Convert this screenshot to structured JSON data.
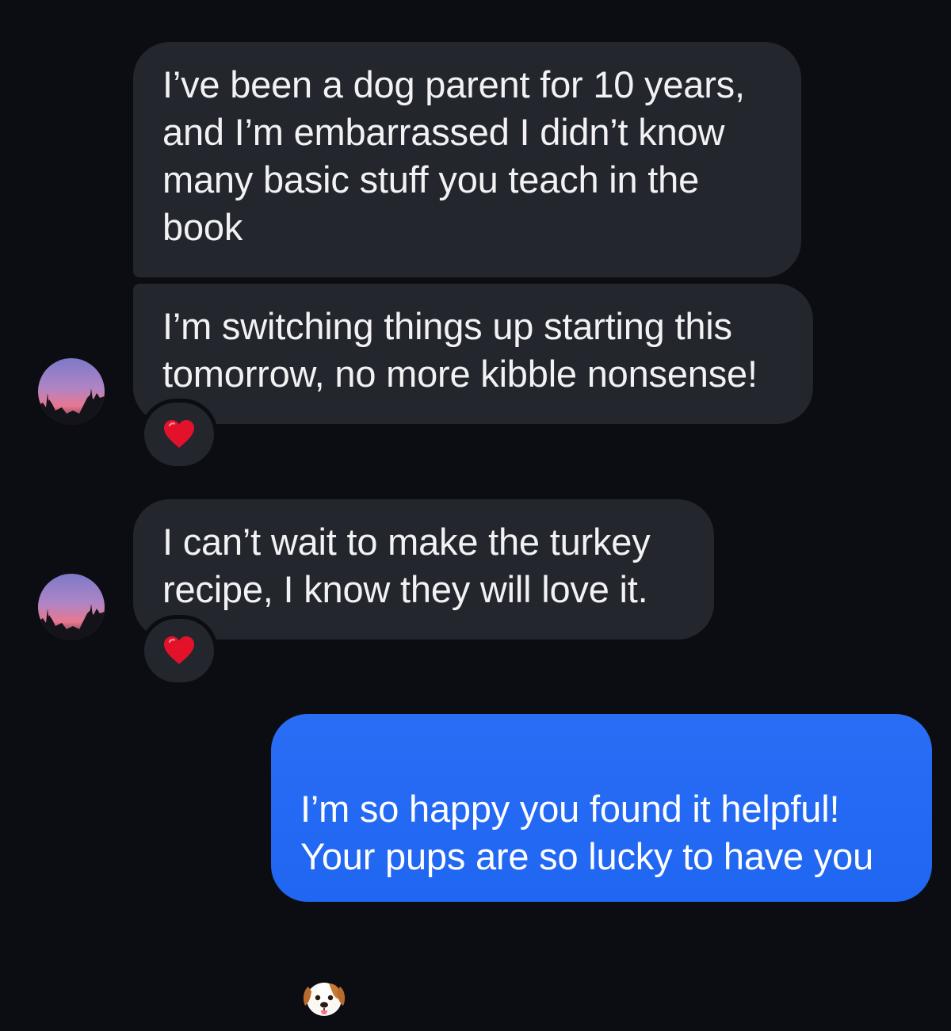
{
  "conversation": {
    "messages": [
      {
        "sender": "them",
        "text": "I’ve been a dog parent for 10 years,\nand I’m embarrassed I didn’t know\nmany basic stuff you teach in the\nbook"
      },
      {
        "sender": "them",
        "text": "I’m switching things up starting this\ntomorrow, no more kibble nonsense!",
        "reaction": "heart"
      },
      {
        "sender": "them",
        "text": "I can’t wait to make the turkey\nrecipe, I know they will love it.",
        "reaction": "heart"
      },
      {
        "sender": "me",
        "text": "I’m so happy you found it helpful!\nYour pups are so lucky to have you",
        "trailing_emoji": "dog-face"
      }
    ]
  },
  "colors": {
    "background": "#0b0d12",
    "incoming_bubble": "#23262d",
    "outgoing_bubble": "#1f66f2",
    "reaction_heart": "#e4112b"
  }
}
